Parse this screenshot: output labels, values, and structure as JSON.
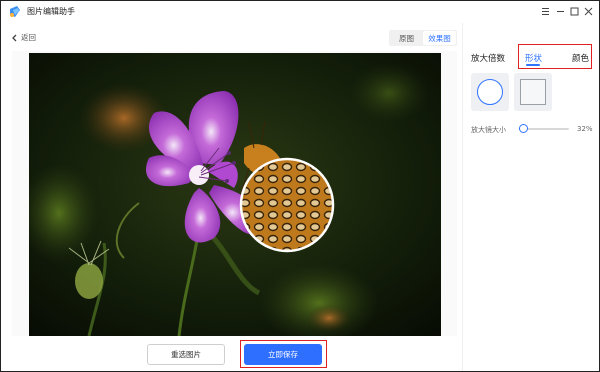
{
  "app": {
    "title": "图片编辑助手",
    "icon": "app-logo-icon"
  },
  "window_controls": {
    "menu_icon": "menu-icon",
    "minimize_icon": "minimize-icon",
    "maximize_icon": "maximize-icon",
    "close_icon": "close-icon"
  },
  "toolbar": {
    "back_label": "返回",
    "view_tabs": [
      {
        "label": "原图",
        "active": false
      },
      {
        "label": "效果图",
        "active": true
      }
    ]
  },
  "panel": {
    "tabs": [
      {
        "label": "放大倍数",
        "active": false
      },
      {
        "label": "形状",
        "active": true
      },
      {
        "label": "颜色",
        "active": false
      }
    ],
    "shapes": [
      {
        "name": "circle",
        "selected": true
      },
      {
        "name": "square",
        "selected": false
      }
    ],
    "slider": {
      "label": "放大镜大小",
      "value_text": "32%",
      "value": 0.32
    }
  },
  "actions": {
    "reselect_label": "重选图片",
    "save_label": "立即保存"
  },
  "colors": {
    "accent": "#2f73ff",
    "highlight_border": "#e02020"
  }
}
